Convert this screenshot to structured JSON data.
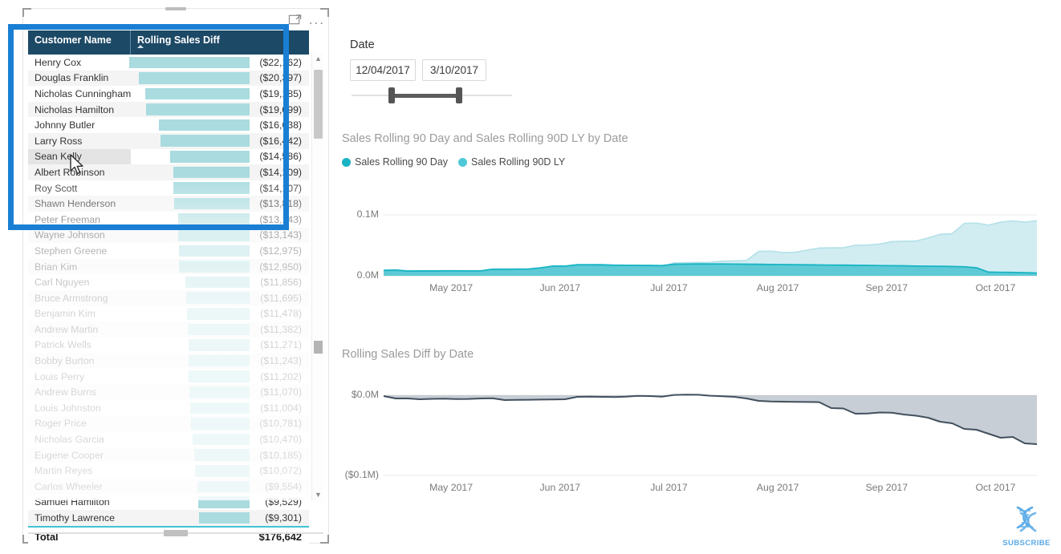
{
  "table_visual": {
    "toolbar": {
      "focus_icon": "focus-mode-icon",
      "more_icon": "more-options-icon",
      "more_label": "..."
    },
    "columns": [
      {
        "label": "Customer Name",
        "sorted": false
      },
      {
        "label": "Rolling Sales Diff",
        "sorted": true,
        "sort_direction": "ascending"
      }
    ],
    "rows": [
      {
        "name": "Henry Cox",
        "value": "($22,162)",
        "magnitude": 22162
      },
      {
        "name": "Douglas Franklin",
        "value": "($20,397)",
        "magnitude": 20397
      },
      {
        "name": "Nicholas Cunningham",
        "value": "($19,185)",
        "magnitude": 19185
      },
      {
        "name": "Nicholas Hamilton",
        "value": "($19,099)",
        "magnitude": 19099
      },
      {
        "name": "Johnny Butler",
        "value": "($16,638)",
        "magnitude": 16638
      },
      {
        "name": "Larry Ross",
        "value": "($16,442)",
        "magnitude": 16442
      },
      {
        "name": "Sean Kelly",
        "value": "($14,586)",
        "magnitude": 14586
      },
      {
        "name": "Albert Robinson",
        "value": "($14,109)",
        "magnitude": 14109
      },
      {
        "name": "Roy Scott",
        "value": "($14,107)",
        "magnitude": 14107
      },
      {
        "name": "Shawn Henderson",
        "value": "($13,818)",
        "magnitude": 13818
      },
      {
        "name": "Peter Freeman",
        "value": "($13,143)",
        "magnitude": 13143
      },
      {
        "name": "Wayne Johnson",
        "value": "($13,143)",
        "magnitude": 13143
      },
      {
        "name": "Stephen Greene",
        "value": "($12,975)",
        "magnitude": 12975
      },
      {
        "name": "Brian Kim",
        "value": "($12,950)",
        "magnitude": 12950
      },
      {
        "name": "Carl Nguyen",
        "value": "($11,856)",
        "magnitude": 11856
      },
      {
        "name": "Bruce Armstrong",
        "value": "($11,695)",
        "magnitude": 11695
      },
      {
        "name": "Benjamin Kim",
        "value": "($11,478)",
        "magnitude": 11478
      },
      {
        "name": "Andrew Martin",
        "value": "($11,382)",
        "magnitude": 11382
      },
      {
        "name": "Patrick Wells",
        "value": "($11,271)",
        "magnitude": 11271
      },
      {
        "name": "Bobby Burton",
        "value": "($11,243)",
        "magnitude": 11243
      },
      {
        "name": "Louis Perry",
        "value": "($11,202)",
        "magnitude": 11202
      },
      {
        "name": "Andrew Burns",
        "value": "($11,070)",
        "magnitude": 11070
      },
      {
        "name": "Louis Johnston",
        "value": "($11,004)",
        "magnitude": 11004
      },
      {
        "name": "Roger Price",
        "value": "($10,781)",
        "magnitude": 10781
      },
      {
        "name": "Nicholas Garcia",
        "value": "($10,470)",
        "magnitude": 10470
      },
      {
        "name": "Eugene Cooper",
        "value": "($10,185)",
        "magnitude": 10185
      },
      {
        "name": "Martin Reyes",
        "value": "($10,072)",
        "magnitude": 10072
      },
      {
        "name": "Carlos Wheeler",
        "value": "($9,554)",
        "magnitude": 9554
      },
      {
        "name": "Samuel Hamilton",
        "value": "($9,529)",
        "magnitude": 9529
      },
      {
        "name": "Timothy Lawrence",
        "value": "($9,301)",
        "magnitude": 9301
      }
    ],
    "hovered_row_index": 6,
    "total": {
      "label": "Total",
      "value": "$176,642"
    },
    "bar_color": "#a9dbdf",
    "header_bg": "#1c4966",
    "selection_border_color": "#1a7fd4"
  },
  "slicer": {
    "label": "Date",
    "start_value": "12/04/2017",
    "end_value": "3/10/2017"
  },
  "chart_data": [
    {
      "type": "area",
      "title": "Sales Rolling 90 Day and Sales Rolling 90D LY by Date",
      "xlabel": "",
      "ylabel": "",
      "ylim": [
        0,
        0.1
      ],
      "ytick_labels": [
        "0.1M",
        "0.0M"
      ],
      "xtick_labels": [
        "May 2017",
        "Jun 2017",
        "Jul 2017",
        "Aug 2017",
        "Sep 2017",
        "Oct 2017"
      ],
      "grid": true,
      "legend_position": "top-left",
      "legend": [
        "Sales Rolling 90 Day",
        "Sales Rolling 90D LY"
      ],
      "series": [
        {
          "name": "Sales Rolling 90 Day",
          "color": "#18b4c4",
          "values": [
            0.009,
            0.0095,
            0.0078,
            0.008,
            0.008,
            0.0082,
            0.0082,
            0.0081,
            0.0081,
            0.0108,
            0.0108,
            0.011,
            0.0112,
            0.0132,
            0.016,
            0.016,
            0.0183,
            0.0183,
            0.0182,
            0.0175,
            0.0173,
            0.017,
            0.017,
            0.0168,
            0.019,
            0.0192,
            0.0195,
            0.0193,
            0.0193,
            0.0192,
            0.019,
            0.0188,
            0.0186,
            0.0184,
            0.0182,
            0.018,
            0.0178,
            0.0176,
            0.0175,
            0.0172,
            0.017,
            0.0168,
            0.0166,
            0.0164,
            0.016,
            0.0158,
            0.0156,
            0.0152,
            0.0148,
            0.0132,
            0.006,
            0.0058,
            0.0056,
            0.005,
            0.0045
          ]
        },
        {
          "name": "Sales Rolling 90D LY",
          "color": "#b6e2ea",
          "values": [
            0.0075,
            0.0078,
            0.0072,
            0.0073,
            0.0074,
            0.0076,
            0.0077,
            0.0078,
            0.008,
            0.0104,
            0.0106,
            0.0108,
            0.011,
            0.0128,
            0.0158,
            0.0159,
            0.0165,
            0.0168,
            0.016,
            0.015,
            0.0168,
            0.0172,
            0.016,
            0.0148,
            0.021,
            0.0215,
            0.0218,
            0.022,
            0.024,
            0.0245,
            0.025,
            0.04,
            0.0405,
            0.038,
            0.0385,
            0.042,
            0.0455,
            0.0458,
            0.046,
            0.05,
            0.0505,
            0.052,
            0.056,
            0.0565,
            0.057,
            0.062,
            0.068,
            0.069,
            0.086,
            0.0865,
            0.083,
            0.088,
            0.09,
            0.088,
            0.0905
          ]
        }
      ]
    },
    {
      "type": "area",
      "title": "Rolling Sales Diff by Date",
      "xlabel": "",
      "ylabel": "",
      "ylim": [
        -0.1,
        0.0
      ],
      "ytick_labels": [
        "$0.0M",
        "($0.1M)"
      ],
      "xtick_labels": [
        "May 2017",
        "Jun 2017",
        "Jul 2017",
        "Aug 2017",
        "Sep 2017",
        "Oct 2017"
      ],
      "grid": true,
      "legend_position": "none",
      "legend": [],
      "series": [
        {
          "name": "Rolling Sales Diff",
          "color": "#42505e",
          "fill_color": "#9aa6b2",
          "values": [
            -0.001,
            -0.004,
            -0.004,
            -0.005,
            -0.0045,
            -0.0042,
            -0.0048,
            -0.0046,
            -0.004,
            -0.0038,
            -0.006,
            -0.0058,
            -0.0056,
            -0.0054,
            -0.0052,
            -0.005,
            -0.002,
            -0.0018,
            -0.002,
            -0.0022,
            -0.0018,
            -0.0008,
            -0.001,
            -0.0018,
            0.0004,
            0.0008,
            0.0006,
            -0.0006,
            -0.0012,
            -0.002,
            -0.004,
            -0.007,
            -0.0078,
            -0.008,
            -0.0082,
            -0.0084,
            -0.0086,
            -0.016,
            -0.0165,
            -0.023,
            -0.0228,
            -0.0215,
            -0.0218,
            -0.024,
            -0.0255,
            -0.028,
            -0.033,
            -0.035,
            -0.042,
            -0.043,
            -0.048,
            -0.053,
            -0.052,
            -0.06,
            -0.061
          ]
        }
      ]
    }
  ],
  "watermark": {
    "icon": "dna-helix-icon",
    "label": "SUBSCRIBE",
    "color": "#5aa9e6"
  }
}
